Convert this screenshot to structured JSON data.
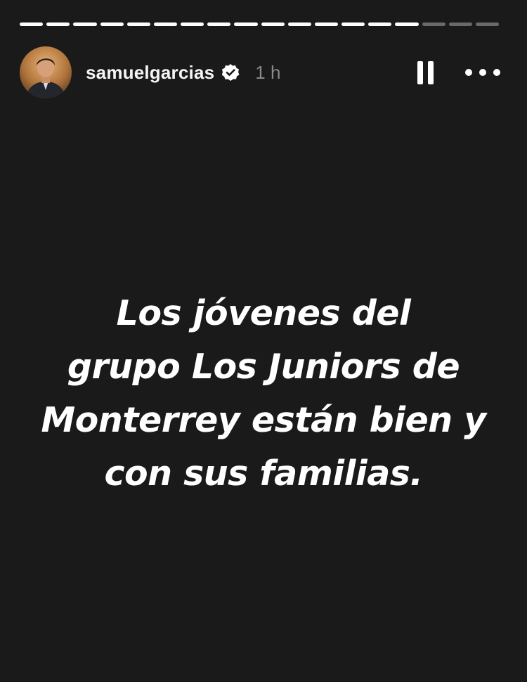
{
  "story": {
    "segments": [
      {
        "progress": 1.0
      },
      {
        "progress": 1.0
      },
      {
        "progress": 1.0
      },
      {
        "progress": 1.0
      },
      {
        "progress": 1.0
      },
      {
        "progress": 1.0
      },
      {
        "progress": 1.0
      },
      {
        "progress": 1.0
      },
      {
        "progress": 1.0
      },
      {
        "progress": 1.0
      },
      {
        "progress": 1.0
      },
      {
        "progress": 1.0
      },
      {
        "progress": 1.0
      },
      {
        "progress": 1.0
      },
      {
        "progress": 1.0
      },
      {
        "progress": 0.0
      },
      {
        "progress": 0.0
      },
      {
        "progress": 0.0
      }
    ],
    "header": {
      "username": "samuelgarcias",
      "verified": true,
      "time": "1 h",
      "pause_icon": "pause-icon",
      "more_icon": "more-options-icon"
    },
    "text_lines": [
      "Los jóvenes del",
      "grupo Los Juniors de",
      "Monterrey están bien y",
      "con sus familias."
    ],
    "colors": {
      "background": "#1a1a1a",
      "text": "#ffffff",
      "timestamp": "#8a8a8a"
    }
  }
}
